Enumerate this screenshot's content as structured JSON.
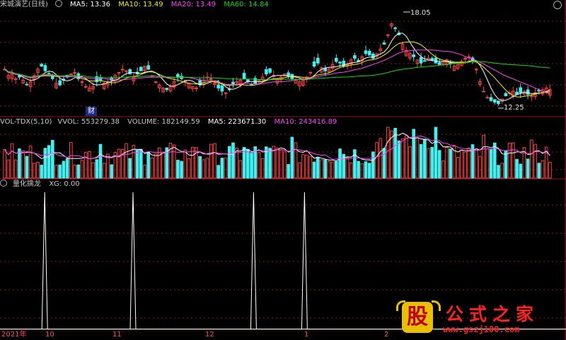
{
  "colors": {
    "up": "#ff4040",
    "down": "#40f0f0",
    "ma5": "#ffffff",
    "ma10": "#f0f000",
    "ma20": "#ff40ff",
    "ma60": "#00e000",
    "grid": "#8b1a1a",
    "volma5": "#ffffff",
    "volma10": "#ff40ff"
  },
  "price_panel": {
    "title": "宋城演艺(日线)",
    "ma5": "MA5: 13.36",
    "ma10": "MA10: 13.49",
    "ma20": "MA20: 13.49",
    "ma60": "MA60: 14.84",
    "high_label": "18.05",
    "low_label": "12.25",
    "badge": "财"
  },
  "volume_panel": {
    "name": "VOL-TDX(5,10)",
    "vvol": "VVOL: 553279.38",
    "volume": "VOLUME: 182149.59",
    "ma5": "MA5: 223671.30",
    "ma10": "MA10: 243416.89"
  },
  "indicator_panel": {
    "name": "量化擒龙",
    "xg": "XG: 0.00"
  },
  "time_axis": {
    "labels": [
      "2021年",
      "10",
      "11",
      "12",
      "1",
      "2"
    ]
  },
  "logo": {
    "gu": "股",
    "text": "公式之家",
    "url": "www.gszj100.com"
  },
  "chart_data": [
    {
      "type": "candlestick",
      "title": "宋城演艺(日线)",
      "max_label": 18.05,
      "min_label": 12.25,
      "ylim": [
        11.8,
        18.3
      ],
      "seed": [
        14.6,
        14.2,
        14.3,
        14.0,
        14.1,
        13.9,
        13.6,
        13.8,
        14.2,
        14.6,
        14.8,
        14.5,
        14.3,
        14.0,
        13.7,
        13.6,
        13.9,
        14.1,
        14.3,
        14.4,
        14.0,
        13.8,
        13.5,
        13.4,
        13.5,
        13.8,
        13.9,
        13.7,
        13.8,
        13.9,
        14.2,
        14.4,
        14.6,
        14.5,
        14.3,
        14.1,
        14.3,
        14.5,
        14.8,
        14.6,
        14.2,
        13.8,
        13.6,
        13.4,
        13.3,
        13.5,
        13.8,
        14.1,
        14.0,
        13.9,
        13.7,
        13.5,
        13.4,
        13.6,
        13.9,
        14.1,
        14.0,
        13.7,
        13.4,
        13.2,
        13.1,
        13.3,
        13.6,
        13.8,
        13.9,
        14.0,
        13.8,
        13.6,
        13.7,
        13.9,
        14.1,
        14.3,
        14.4,
        14.2,
        14.0,
        14.1,
        14.3,
        14.2,
        14.0,
        13.9,
        13.8,
        13.9,
        14.1,
        14.4,
        14.8,
        15.0,
        14.7,
        14.5,
        14.6,
        14.9,
        15.1,
        15.0,
        14.8,
        14.9,
        15.2,
        15.3,
        15.1,
        15.4,
        15.6,
        15.5,
        15.3,
        15.6,
        15.9,
        16.2,
        16.8,
        17.5,
        17.2,
        16.8,
        16.2,
        15.8,
        15.6,
        15.4,
        15.2,
        15.0,
        15.1,
        15.3,
        15.2,
        15.0,
        14.9,
        15.1,
        15.2,
        15.0,
        14.8,
        14.9,
        15.1,
        15.3,
        15.4,
        15.2,
        14.6,
        13.8,
        13.2,
        12.8,
        12.6,
        12.5,
        12.4,
        12.7,
        12.9,
        13.1,
        13.2,
        13.0,
        13.1,
        13.2,
        13.0,
        12.9,
        13.1,
        13.2,
        13.3,
        13.4,
        13.3
      ]
    },
    {
      "type": "bar",
      "title": "VOL-TDX(5,10)",
      "vvol": 553279.38,
      "volume": 182149.59,
      "ma5": 223671.3,
      "ma10": 243416.89
    },
    {
      "type": "line",
      "title": "量化擒龙",
      "series": [
        {
          "name": "XG",
          "peaks_at_fraction": [
            0.079,
            0.235,
            0.448,
            0.538
          ]
        }
      ],
      "ylim": [
        0,
        1
      ]
    }
  ]
}
